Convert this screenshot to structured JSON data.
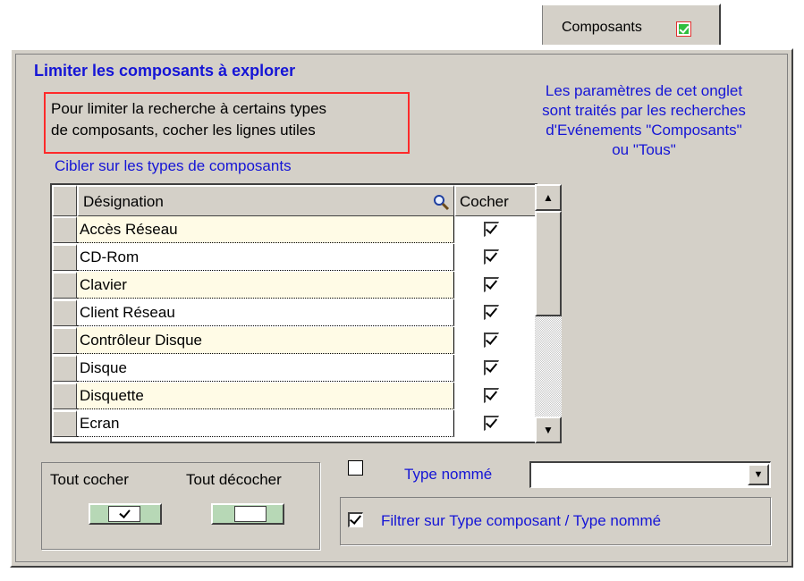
{
  "tab": {
    "label": "Composants",
    "checked": true
  },
  "section_title": "Limiter les composants à explorer",
  "note_lines": [
    "Pour limiter la recherche à certains types",
    "de composants, cocher les lignes utiles"
  ],
  "info_lines": [
    "Les paramètres de cet onglet",
    "sont traités par les recherches",
    "d'Evénements \"Composants\"",
    "ou \"Tous\""
  ],
  "grid_title": "Cibler sur les types de composants",
  "grid": {
    "col_designation": "Désignation",
    "col_cocher": "Cocher",
    "rows": [
      {
        "label": "Accès Réseau",
        "checked": true
      },
      {
        "label": "CD-Rom",
        "checked": true
      },
      {
        "label": "Clavier",
        "checked": true
      },
      {
        "label": "Client Réseau",
        "checked": true
      },
      {
        "label": "Contrôleur Disque",
        "checked": true
      },
      {
        "label": "Disque",
        "checked": true
      },
      {
        "label": "Disquette",
        "checked": true
      },
      {
        "label": "Ecran",
        "checked": true
      }
    ]
  },
  "buttons": {
    "check_all": "Tout cocher",
    "uncheck_all": "Tout décocher"
  },
  "type_nomme": {
    "label": "Type nommé",
    "checked": false,
    "value": ""
  },
  "filter": {
    "label": "Filtrer sur Type composant / Type nommé",
    "checked": true
  },
  "colors": {
    "accent_text": "#1515d6",
    "panel": "#d4d0c8",
    "note_border": "#ff2a2a",
    "row_alt": "#fffbe6"
  }
}
